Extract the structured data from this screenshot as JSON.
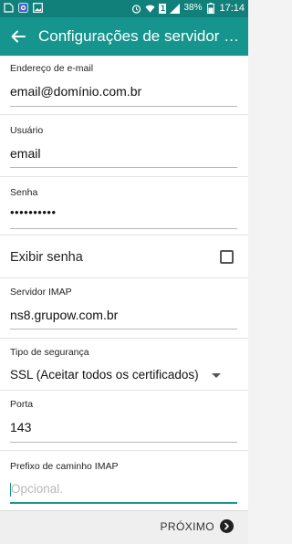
{
  "status_bar": {
    "battery_percent": "38%",
    "time": "17:14",
    "sim_badge": "1",
    "left_icons": [
      "sim-icon",
      "app-notification-icon",
      "image-icon"
    ],
    "right_icons": [
      "alarm-icon",
      "wifi-icon",
      "sim-badge",
      "signal-icon",
      "battery-icon"
    ]
  },
  "app_bar": {
    "title": "Configurações de servidor d..."
  },
  "form": {
    "email": {
      "label": "Endereço de e-mail",
      "value": "email@domínio.com.br"
    },
    "username": {
      "label": "Usuário",
      "value": "email"
    },
    "password": {
      "label": "Senha",
      "value": "••••••••••"
    },
    "show_password": {
      "label": "Exibir senha",
      "checked": false
    },
    "imap_server": {
      "label": "Servidor IMAP",
      "value": "ns8.grupow.com.br"
    },
    "security_type": {
      "label": "Tipo de segurança",
      "value": "SSL (Aceitar todos os certificados)"
    },
    "port": {
      "label": "Porta",
      "value": "143"
    },
    "imap_path_prefix": {
      "label": "Prefixo de caminho IMAP",
      "placeholder": "Opcional."
    }
  },
  "bottom_bar": {
    "next_label": "PRÓXIMO"
  },
  "colors": {
    "status_bar": "#11807a",
    "app_bar": "#15958d",
    "accent": "#14958d"
  }
}
